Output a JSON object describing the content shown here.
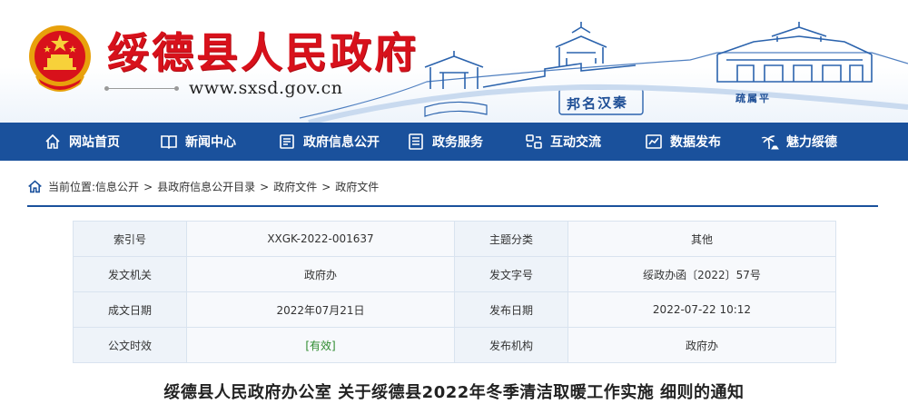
{
  "header": {
    "site_title": "绥德县人民政府",
    "site_url": "www.sxsd.gov.cn",
    "seal_left": "邦名汉秦",
    "seal_right": "疏属平"
  },
  "nav": {
    "items": [
      {
        "label": "网站首页",
        "icon": "home-icon"
      },
      {
        "label": "新闻中心",
        "icon": "book-icon"
      },
      {
        "label": "政府信息公开",
        "icon": "document-icon"
      },
      {
        "label": "政务服务",
        "icon": "list-icon"
      },
      {
        "label": "互动交流",
        "icon": "exchange-icon"
      },
      {
        "label": "数据发布",
        "icon": "chart-icon"
      },
      {
        "label": "魅力绥德",
        "icon": "palm-tree-icon"
      }
    ]
  },
  "breadcrumb": {
    "prefix": "当前位置:",
    "items": [
      "信息公开",
      "县政府信息公开目录",
      "政府文件",
      "政府文件"
    ],
    "separator": ">"
  },
  "info": {
    "rows": [
      {
        "k1": "索引号",
        "v1": "XXGK-2022-001637",
        "k2": "主题分类",
        "v2": "其他"
      },
      {
        "k1": "发文机关",
        "v1": "政府办",
        "k2": "发文字号",
        "v2": "绥政办函〔2022〕57号"
      },
      {
        "k1": "成文日期",
        "v1": "2022年07月21日",
        "k2": "发布日期",
        "v2": "2022-07-22 10:12"
      },
      {
        "k1": "公文时效",
        "v1": "[有效]",
        "k2": "发布机构",
        "v2": "政府办"
      }
    ]
  },
  "document": {
    "title": "绥德县人民政府办公室 关于绥德县2022年冬季清洁取暖工作实施 细则的通知"
  },
  "colors": {
    "brand_red": "#d8111b",
    "nav_blue": "#1a519c",
    "valid_green": "#2e8b2e"
  }
}
